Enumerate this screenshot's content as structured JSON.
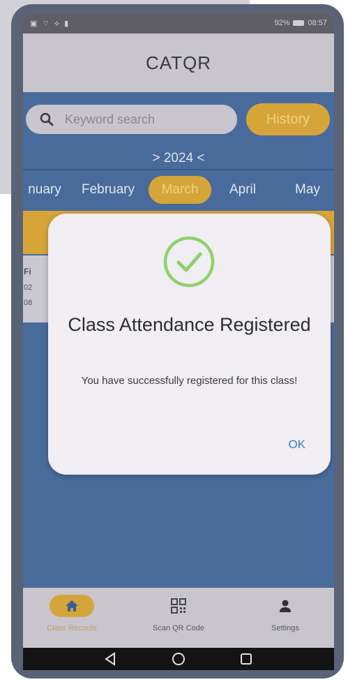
{
  "status": {
    "left_icons": "▣ ⌔ ⟡ ▮",
    "battery": "92%",
    "time": "08:57"
  },
  "app": {
    "title": "CATQR"
  },
  "search": {
    "placeholder": "Keyword search"
  },
  "history_button": "History",
  "year_label": "> 2024 <",
  "months": [
    {
      "label": "nuary",
      "active": false
    },
    {
      "label": "February",
      "active": false
    },
    {
      "label": "March",
      "active": true
    },
    {
      "label": "April",
      "active": false
    },
    {
      "label": "May",
      "active": false
    }
  ],
  "list_fragment": [
    "Fi",
    "02",
    "08"
  ],
  "dialog": {
    "title": "Class Attendance Registered",
    "message": "You have successfully registered for this class!",
    "ok_label": "OK"
  },
  "bottom_nav": [
    {
      "label": "Class Records",
      "icon": "home-icon",
      "active": true
    },
    {
      "label": "Scan QR Code",
      "icon": "qr-code-icon",
      "active": false
    },
    {
      "label": "Settings",
      "icon": "person-icon",
      "active": false
    }
  ],
  "colors": {
    "accent": "#d6a53a",
    "background": "#486b9b",
    "success": "#8fd16a",
    "link": "#3a7bc7"
  }
}
